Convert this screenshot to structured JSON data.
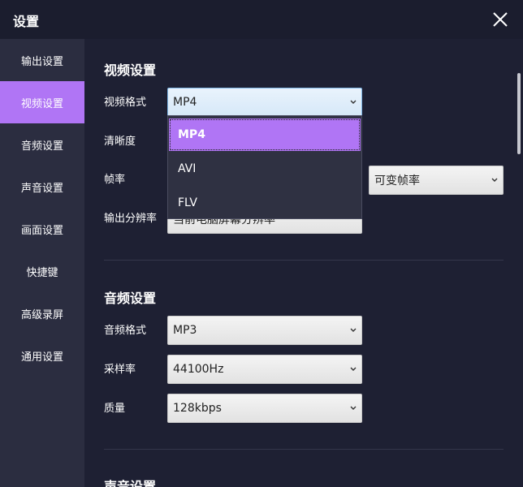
{
  "window": {
    "title": "设置",
    "close_icon": "close-icon"
  },
  "sidebar": {
    "active_color": "#b075f5",
    "items": [
      {
        "label": "输出设置"
      },
      {
        "label": "视频设置",
        "active": true
      },
      {
        "label": "音频设置"
      },
      {
        "label": "声音设置"
      },
      {
        "label": "画面设置"
      },
      {
        "label": "快捷键"
      },
      {
        "label": "高级录屏"
      },
      {
        "label": "通用设置"
      }
    ]
  },
  "video": {
    "title": "视频设置",
    "format_label": "视频格式",
    "format_value": "MP4",
    "clarity_label": "清晰度",
    "framerate_label": "帧率",
    "framerate_mode_value": "可变帧率",
    "resolution_label": "输出分辨率",
    "resolution_value": "当前电脑屏幕分辨率"
  },
  "format_dropdown": {
    "options": [
      "MP4",
      "AVI",
      "FLV"
    ],
    "selected": "MP4"
  },
  "audio": {
    "title": "音频设置",
    "format_label": "音频格式",
    "format_value": "MP3",
    "samplerate_label": "采样率",
    "samplerate_value": "44100Hz",
    "quality_label": "质量",
    "quality_value": "128kbps"
  },
  "sound": {
    "title": "声音设置"
  }
}
